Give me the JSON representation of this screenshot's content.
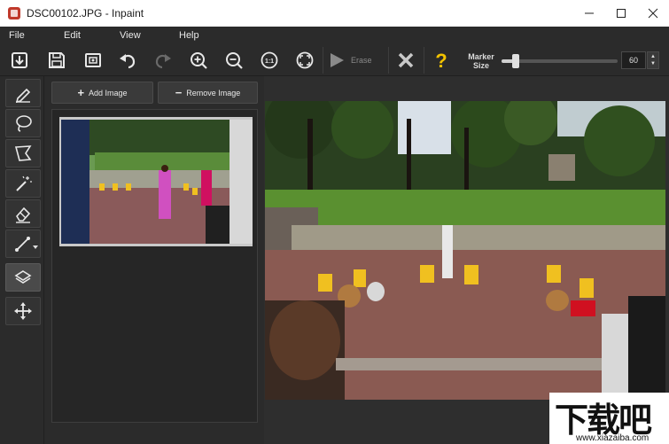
{
  "window": {
    "title": "DSC00102.JPG - Inpaint"
  },
  "menu": [
    "File",
    "Edit",
    "View",
    "Help"
  ],
  "toolbar": {
    "erase_label": "Erase",
    "marker_label_1": "Marker",
    "marker_label_2": "Size",
    "marker_size": "60",
    "marker_size_value": 60,
    "marker_size_fraction": 0.12
  },
  "panel": {
    "add_label": "Add Image",
    "remove_label": "Remove Image"
  },
  "watermark": {
    "logo_text": "下载吧",
    "url": "www.xiazaiba.com"
  },
  "colors": {
    "background": "#2b2b2b",
    "titlebar": "#ffffff",
    "help_icon": "#f2c200",
    "text": "#e8e8e8"
  }
}
